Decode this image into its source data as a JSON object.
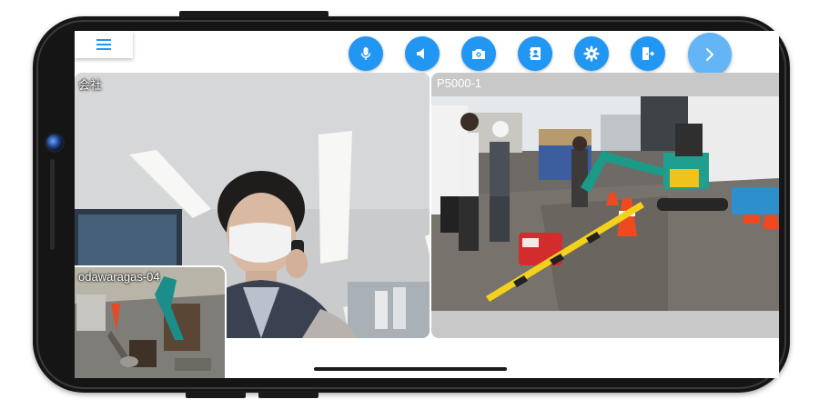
{
  "toolbar": {
    "menu_icon": "hamburger-menu-icon",
    "buttons": [
      {
        "name": "microphone-button",
        "icon": "microphone-icon"
      },
      {
        "name": "speaker-button",
        "icon": "speaker-icon"
      },
      {
        "name": "switch-camera-button",
        "icon": "camera-switch-icon"
      },
      {
        "name": "participants-button",
        "icon": "contact-book-icon"
      },
      {
        "name": "settings-button",
        "icon": "gear-icon"
      },
      {
        "name": "exit-button",
        "icon": "exit-icon"
      }
    ],
    "next_icon": "chevron-right-icon",
    "accent_color": "#2196f3",
    "next_color": "#64b5f6"
  },
  "videos": {
    "office": {
      "label": "会社"
    },
    "pip": {
      "label": "odawaragas-04"
    },
    "site": {
      "label": "P5000-1"
    }
  }
}
